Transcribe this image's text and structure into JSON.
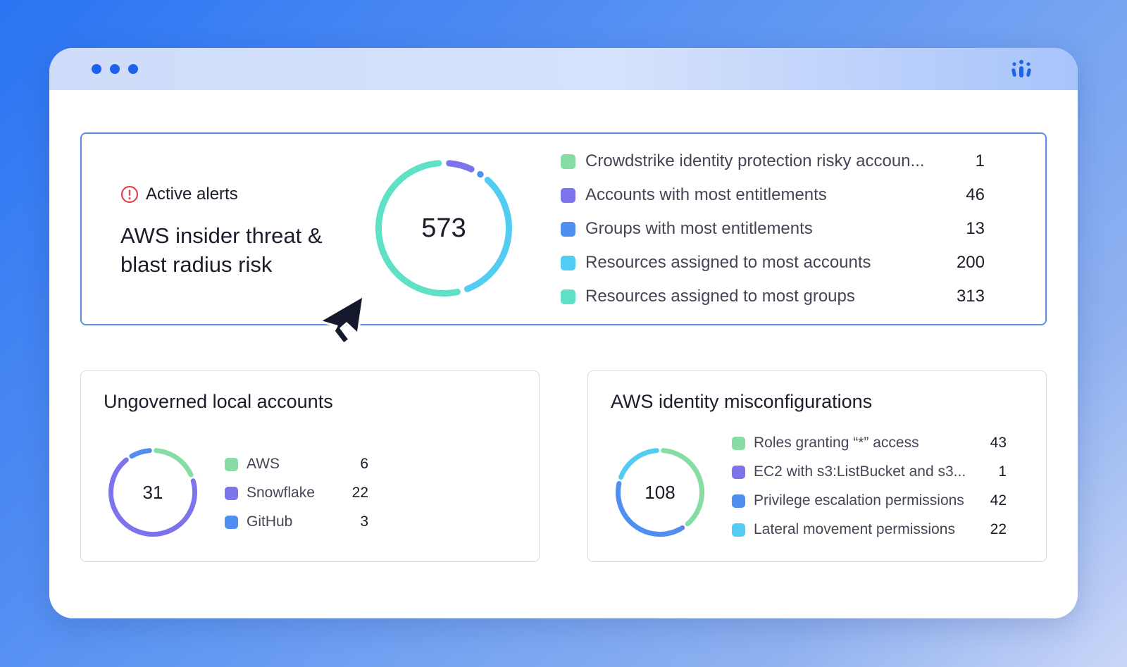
{
  "window": {
    "dots": [
      "dot",
      "dot",
      "dot"
    ],
    "logo_icon": "app-logo-icon"
  },
  "active_alerts": {
    "badge_icon": "alert-circle-icon",
    "badge_label": "Active alerts",
    "title": "AWS insider threat & blast radius risk",
    "total": "573",
    "items": [
      {
        "label": "Crowdstrike identity protection risky accoun...",
        "value": "1",
        "color": "#86dca3"
      },
      {
        "label": "Accounts with most entitlements",
        "value": "46",
        "color": "#7d73ec"
      },
      {
        "label": "Groups with most entitlements",
        "value": "13",
        "color": "#4f8ff0"
      },
      {
        "label": "Resources assigned to most accounts",
        "value": "200",
        "color": "#52ccf3"
      },
      {
        "label": "Resources assigned to most groups",
        "value": "313",
        "color": "#5fe0c7"
      }
    ]
  },
  "ungoverned": {
    "title": "Ungoverned local accounts",
    "total": "31",
    "items": [
      {
        "label": "AWS",
        "value": "6",
        "color": "#86dca3"
      },
      {
        "label": "Snowflake",
        "value": "22",
        "color": "#7d73ec"
      },
      {
        "label": "GitHub",
        "value": "3",
        "color": "#4f8ff0"
      }
    ]
  },
  "misconfig": {
    "title": "AWS identity misconfigurations",
    "total": "108",
    "items": [
      {
        "label": "Roles granting “*” access",
        "value": "43",
        "color": "#86dca3"
      },
      {
        "label": "EC2 with s3:ListBucket and s3...",
        "value": "1",
        "color": "#7d73ec"
      },
      {
        "label": "Privilege escalation permissions",
        "value": "42",
        "color": "#4f8ff0"
      },
      {
        "label": "Lateral movement permissions",
        "value": "22",
        "color": "#52ccf3"
      }
    ]
  },
  "cursor_icon": "mouse-pointer-icon"
}
